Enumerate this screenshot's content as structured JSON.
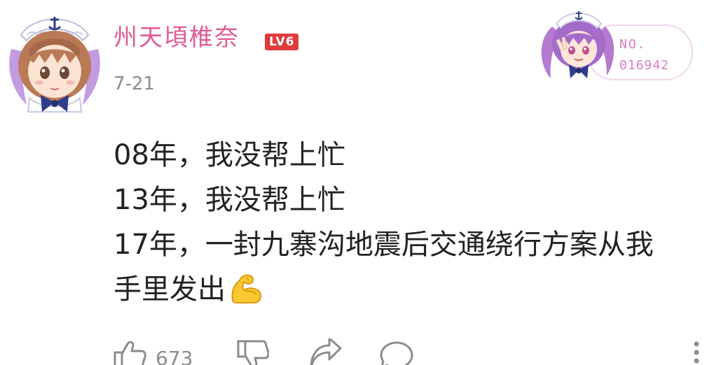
{
  "user": {
    "name": "州天頃椎奈",
    "level": "LV6",
    "date": "7-21"
  },
  "badge": {
    "no_label": "NO.",
    "number": "016942"
  },
  "post": {
    "lines": [
      "08年，我没帮上忙",
      "13年，我没帮上忙",
      "17年，一封九寨沟地震后交通绕行方案从我",
      "手里发出"
    ],
    "emoji": "flexed-biceps"
  },
  "actions": {
    "like_count": "673"
  },
  "colors": {
    "username": "#e05b93",
    "level_badge": "#e03b3b",
    "badge_text": "#d87ac2",
    "muted": "#8c8c8c"
  }
}
